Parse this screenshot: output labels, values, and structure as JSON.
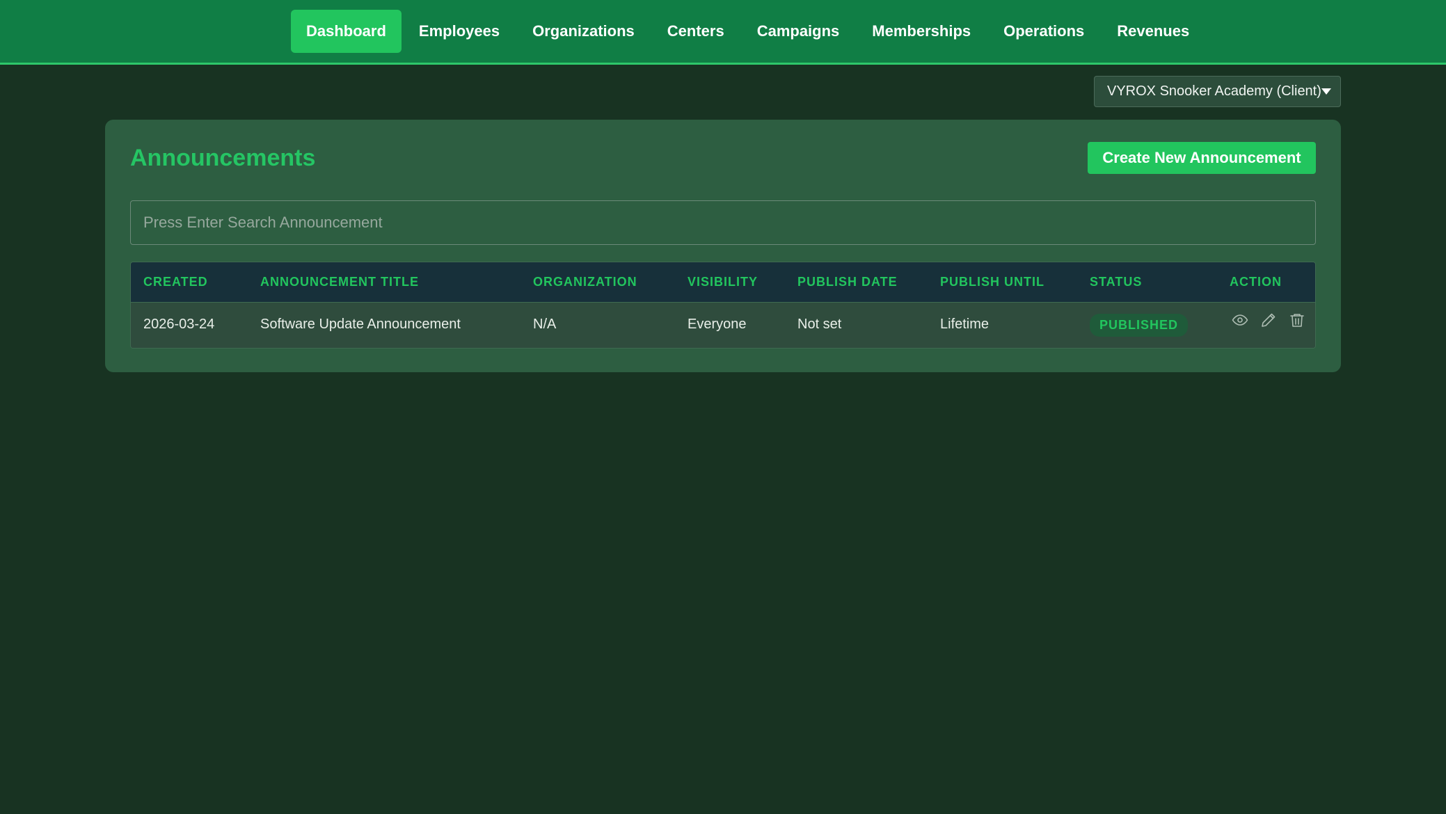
{
  "nav": {
    "items": [
      {
        "label": "Dashboard",
        "active": true
      },
      {
        "label": "Employees"
      },
      {
        "label": "Organizations"
      },
      {
        "label": "Centers"
      },
      {
        "label": "Campaigns"
      },
      {
        "label": "Memberships"
      },
      {
        "label": "Operations"
      },
      {
        "label": "Revenues"
      }
    ]
  },
  "client_select": {
    "value": "VYROX Snooker Academy (Client)"
  },
  "page": {
    "title": "Announcements",
    "create_button": "Create New Announcement",
    "search_placeholder": "Press Enter Search Announcement"
  },
  "table": {
    "columns": [
      "Created",
      "Announcement Title",
      "Organization",
      "Visibility",
      "Publish Date",
      "Publish Until",
      "Status",
      "Action"
    ],
    "rows": [
      {
        "created": "2026-03-24",
        "title": "Software Update Announcement",
        "organization": "N/A",
        "visibility": "Everyone",
        "publish_date": "Not set",
        "publish_until": "Lifetime",
        "status": "PUBLISHED",
        "actions": [
          "eye-icon",
          "pencil-icon",
          "trash-icon"
        ]
      }
    ]
  },
  "colors": {
    "nav_bg": "#107e45",
    "accent": "#22c55e",
    "page_bg": "#183322",
    "panel_bg": "#2d5e41",
    "table_header_bg": "#17303a"
  }
}
